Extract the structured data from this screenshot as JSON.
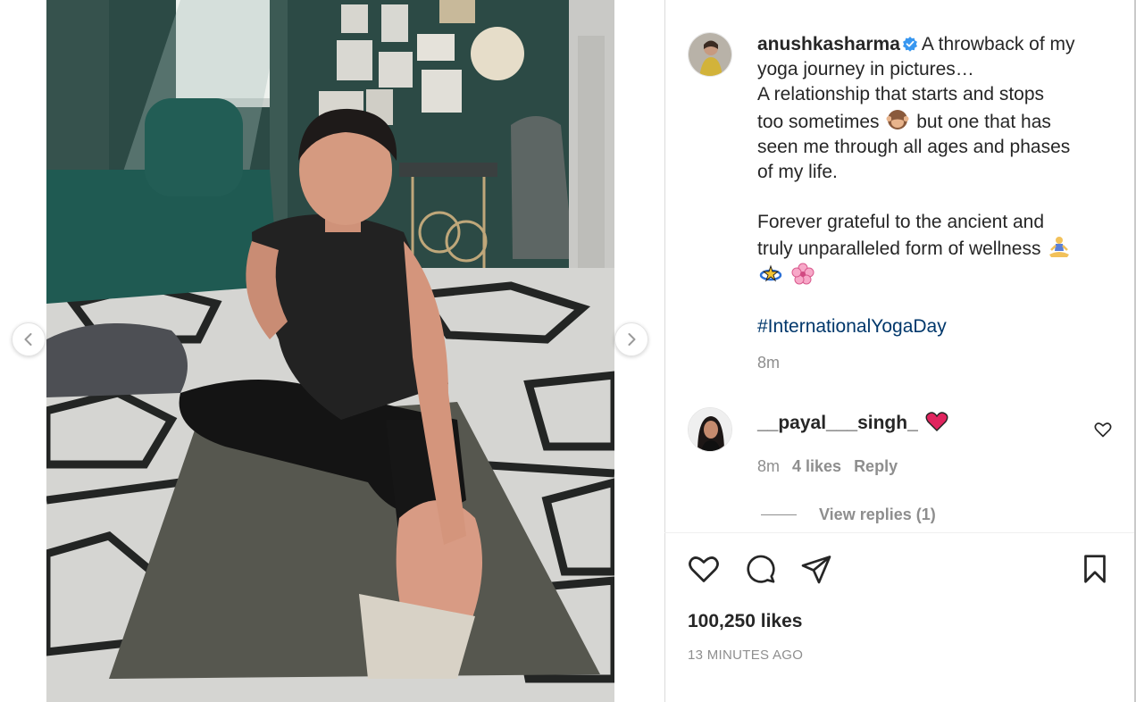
{
  "post": {
    "username": "anushkasharma",
    "caption_line1": "A throwback of my",
    "caption_lines": [
      "yoga journey in pictures…",
      "A relationship that starts and stops",
      "too sometimes",
      "but one that has",
      "seen me through all ages and phases",
      "of my life."
    ],
    "caption_para2": [
      "Forever grateful to the ancient and",
      "truly unparalleled form of wellness"
    ],
    "hashtag": "#InternationalYogaDay",
    "caption_time": "8m",
    "likes": "100,250 likes",
    "posted_ago": "13 MINUTES AGO"
  },
  "comment": {
    "username": "__payal___singh_",
    "time": "8m",
    "likes": "4 likes",
    "reply_label": "Reply",
    "view_replies": "View replies (1)"
  },
  "icons": {
    "prev": "chevron-left-icon",
    "next": "chevron-right-icon",
    "verified": "verified-badge-icon",
    "comment_like": "heart-outline-icon",
    "like": "heart-outline-icon",
    "comment": "speech-bubble-icon",
    "share": "paper-plane-icon",
    "save": "bookmark-icon"
  },
  "colors": {
    "verified": "#3897f0",
    "hashtag": "#00376b",
    "muted": "#8e8e8e",
    "heart_emoji": "#e0245e"
  }
}
